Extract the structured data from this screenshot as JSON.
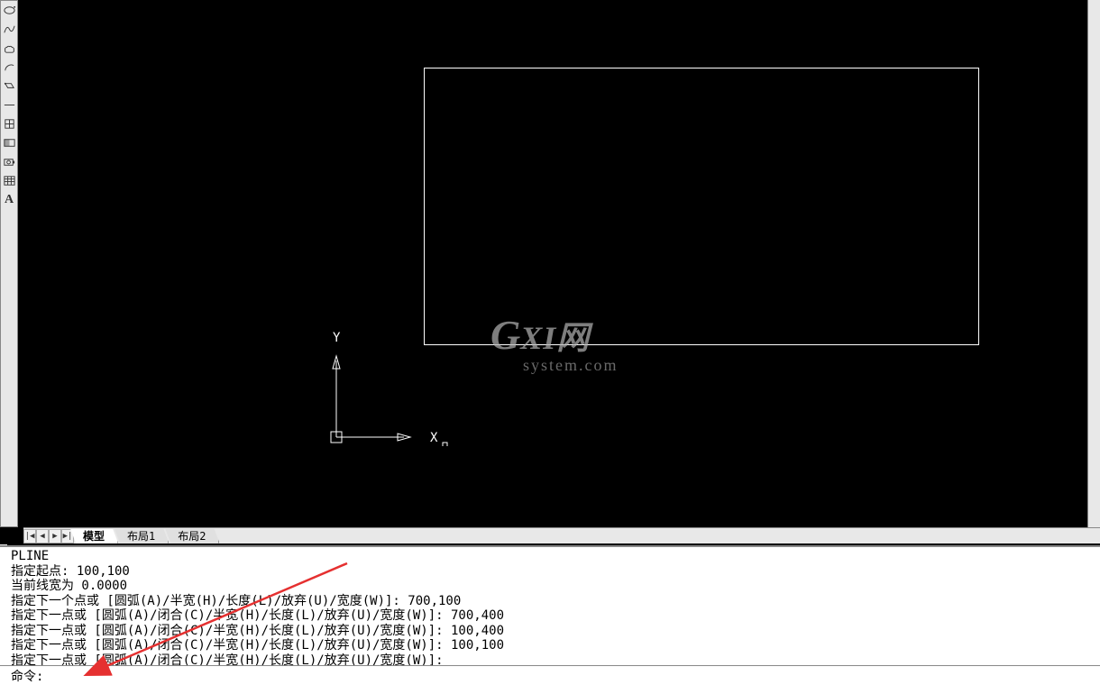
{
  "toolbar": {
    "tools": [
      "ellipse",
      "spline",
      "revcloud",
      "arc-tool",
      "rect-tool",
      "blank1",
      "cross-region",
      "region",
      "camera",
      "table",
      "text"
    ]
  },
  "tabs": {
    "nav": [
      "first",
      "prev",
      "next",
      "last"
    ],
    "items": [
      {
        "label": "模型",
        "active": true
      },
      {
        "label": "布局1",
        "active": false
      },
      {
        "label": "布局2",
        "active": false
      }
    ]
  },
  "ucs": {
    "x": "X",
    "y": "Y"
  },
  "watermark": {
    "brand1": "G",
    "brand2": "XI",
    "brand3": "网",
    "sub": "system.com"
  },
  "commandlog": {
    "lines": [
      "PLINE",
      "指定起点: 100,100",
      "当前线宽为 0.0000",
      "指定下一个点或 [圆弧(A)/半宽(H)/长度(L)/放弃(U)/宽度(W)]: 700,100",
      "指定下一点或 [圆弧(A)/闭合(C)/半宽(H)/长度(L)/放弃(U)/宽度(W)]: 700,400",
      "指定下一点或 [圆弧(A)/闭合(C)/半宽(H)/长度(L)/放弃(U)/宽度(W)]: 100,400",
      "指定下一点或 [圆弧(A)/闭合(C)/半宽(H)/长度(L)/放弃(U)/宽度(W)]: 100,100",
      "指定下一点或 [圆弧(A)/闭合(C)/半宽(H)/长度(L)/放弃(U)/宽度(W)]:"
    ]
  },
  "commandline": {
    "prompt": "命令:",
    "value": ""
  }
}
